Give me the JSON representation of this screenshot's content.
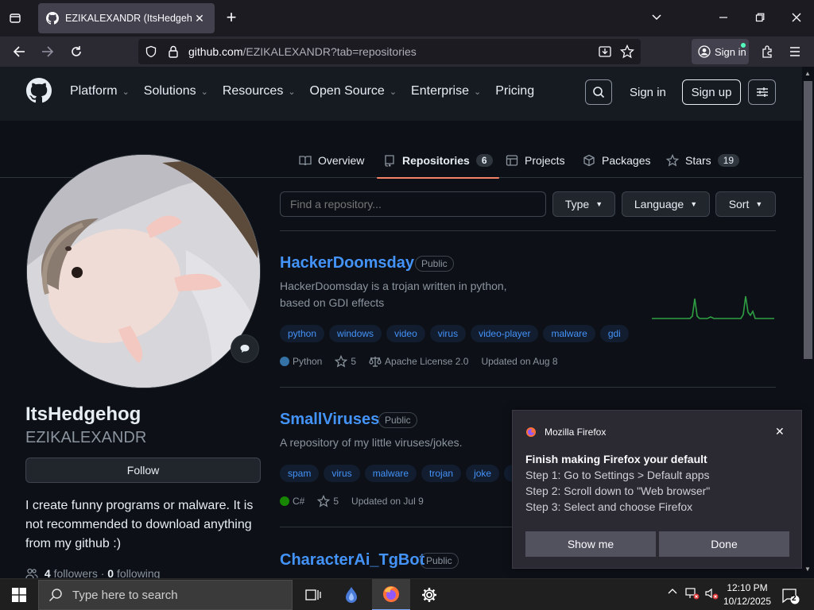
{
  "browser": {
    "tab_title": "EZIKALEXANDR (ItsHedgehog)",
    "url_host": "github.com",
    "url_path": "/EZIKALEXANDR?tab=repositories",
    "sign_in_label": "Sign in"
  },
  "header": {
    "nav": [
      "Platform",
      "Solutions",
      "Resources",
      "Open Source",
      "Enterprise",
      "Pricing"
    ],
    "sign_in": "Sign in",
    "sign_up": "Sign up"
  },
  "profile_tabs": {
    "overview": "Overview",
    "repositories": "Repositories",
    "repositories_count": "6",
    "projects": "Projects",
    "packages": "Packages",
    "stars": "Stars",
    "stars_count": "19"
  },
  "profile": {
    "name": "ItsHedgehog",
    "username": "EZIKALEXANDR",
    "follow_label": "Follow",
    "bio": "I create funny programs or malware. It is not recommended to download anything from my github :)",
    "followers_count": "4",
    "followers_label": "followers",
    "following_count": "0",
    "following_label": "following"
  },
  "filters": {
    "search_placeholder": "Find a repository...",
    "type": "Type",
    "language": "Language",
    "sort": "Sort"
  },
  "repos": [
    {
      "name": "HackerDoomsday",
      "visibility": "Public",
      "description_line1": "HackerDoomsday is a trojan written in python,",
      "description_line2": "based on GDI effects",
      "topics": [
        "python",
        "windows",
        "video",
        "virus",
        "video-player",
        "malware",
        "gdi"
      ],
      "language": "Python",
      "language_color": "#3572A5",
      "stars": "5",
      "license": "Apache License 2.0",
      "updated": "Updated on Aug 8"
    },
    {
      "name": "SmallViruses",
      "visibility": "Public",
      "description": "A repository of my little viruses/jokes.",
      "topics": [
        "spam",
        "virus",
        "malware",
        "trojan",
        "joke",
        "vo"
      ],
      "language": "C#",
      "language_color": "#178600",
      "stars": "5",
      "updated": "Updated on Jul 9"
    },
    {
      "name": "CharacterAi_TgBot",
      "visibility": "Public"
    }
  ],
  "firefox_notification": {
    "app_name": "Mozilla Firefox",
    "title": "Finish making Firefox your default",
    "step1": "Step 1: Go to Settings > Default apps",
    "step2": "Step 2: Scroll down to \"Web browser\"",
    "step3": "Step 3: Select and choose Firefox",
    "show_me": "Show me",
    "done": "Done"
  },
  "taskbar": {
    "search_placeholder": "Type here to search",
    "time": "12:10 PM",
    "date": "10/12/2025",
    "notification_count": "2"
  },
  "colors": {
    "link": "#4493f8",
    "active_tab_underline": "#f78166",
    "sparkline": "#2ea043"
  }
}
